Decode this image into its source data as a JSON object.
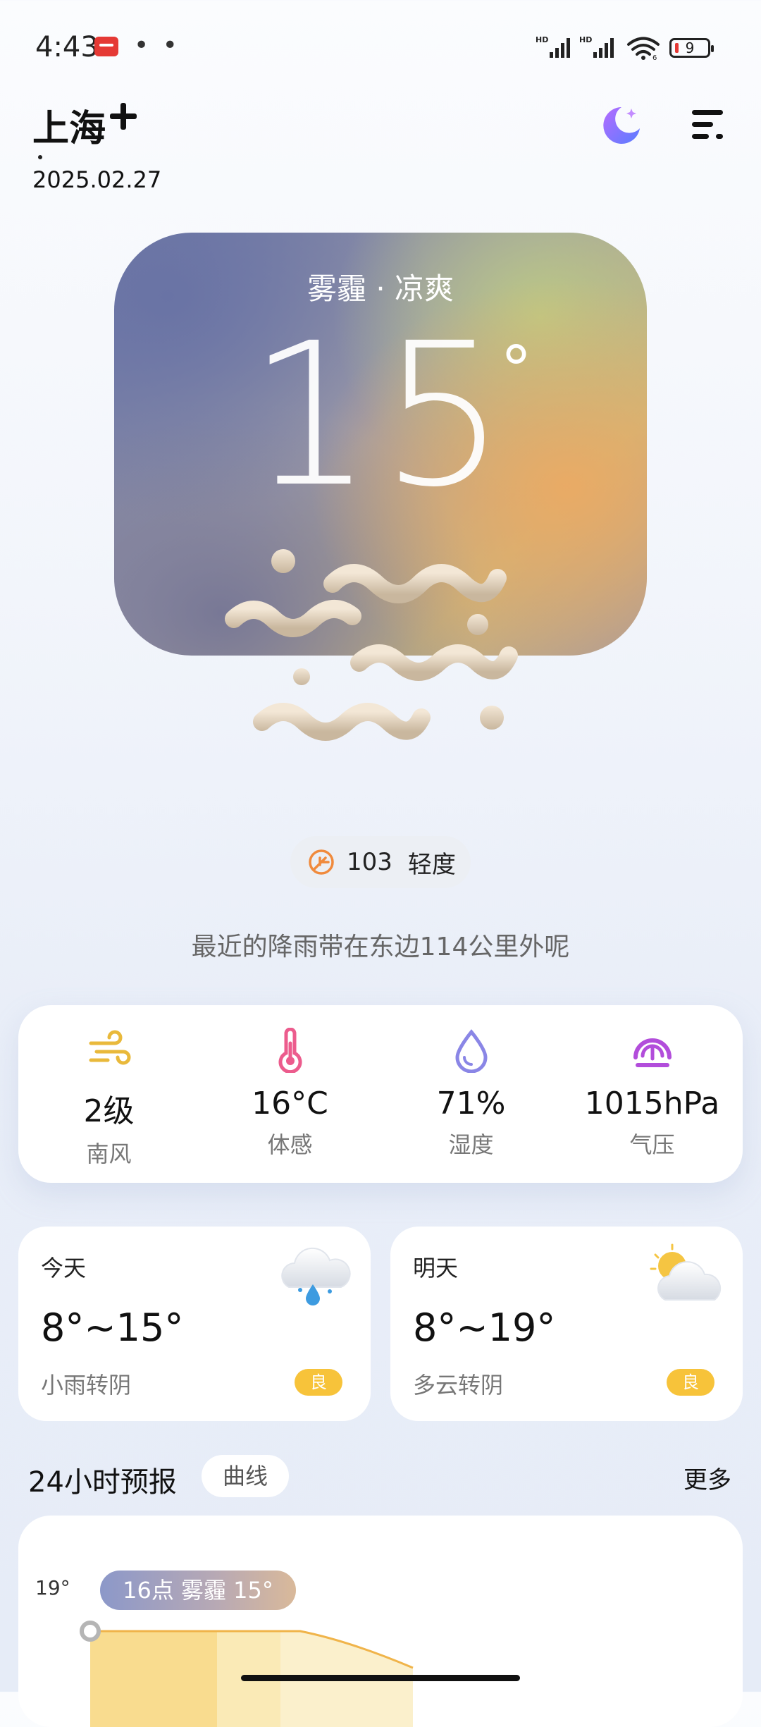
{
  "status_bar": {
    "time": "4:43",
    "dots": "• •",
    "network_1": "HD",
    "network_2": "HD",
    "wifi_label": "6",
    "battery": "9"
  },
  "header": {
    "city": "上海",
    "date": "2025.02.27",
    "add_icon": "plus-icon",
    "moon_icon": "moon-icon",
    "menu_icon": "menu-icon"
  },
  "hero": {
    "condition": "雾霾 · 凉爽",
    "temperature": "15",
    "degree": "°",
    "art_icon": "haze-icon",
    "colors": {
      "purple": "#6d78a6",
      "gold": "#c9b37c",
      "orange": "#eaa864"
    }
  },
  "aqi": {
    "value": "103",
    "level": "轻度",
    "icon": "leaf-icon"
  },
  "rain_note": "最近的降雨带在东边114公里外呢",
  "metrics": [
    {
      "value": "2级",
      "label": "南风",
      "icon": "wind-icon",
      "color": "#e9b93b"
    },
    {
      "value": "16°C",
      "label": "体感",
      "icon": "thermometer-icon",
      "color": "#ec5c8d"
    },
    {
      "value": "71%",
      "label": "湿度",
      "icon": "droplet-icon",
      "color": "#8a86e6"
    },
    {
      "value": "1015hPa",
      "label": "气压",
      "icon": "gauge-icon",
      "color": "#b24ddb"
    }
  ],
  "days": [
    {
      "title": "今天",
      "range": "8°~15°",
      "desc": "小雨转阴",
      "badge": "良",
      "icon": "cloud-rain-icon"
    },
    {
      "title": "明天",
      "range": "8°~19°",
      "desc": "多云转阴",
      "badge": "良",
      "icon": "partly-cloudy-icon"
    }
  ],
  "hourly": {
    "title": "24小时预报",
    "tab": "曲线",
    "more": "更多",
    "max_label": "19°",
    "tooltip": "16点 雾霾 15°"
  }
}
